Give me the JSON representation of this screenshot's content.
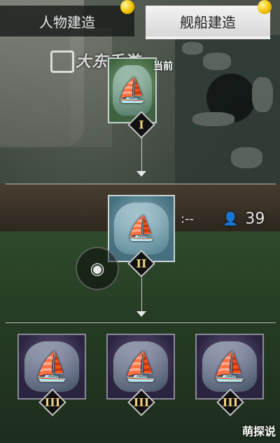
{
  "tabs": {
    "character_build": "人物建造",
    "ship_build": "舰船建造"
  },
  "watermark": "大东手游",
  "current_label": "当前",
  "tiers": {
    "tier1": "I",
    "tier2": "II",
    "tier3": "III"
  },
  "hud": {
    "dash_text": ":--",
    "player_count": "39"
  },
  "corner_logo": "萌探说",
  "icons": {
    "tab_coin": "coin-icon",
    "ship": "ship-icon",
    "eye": "eye-icon",
    "person": "person-icon",
    "chevron": "chevron-down-icon"
  },
  "colors": {
    "tab_active_bg": "#f3f3f3",
    "tab_inactive_bg": "#1a1f1c",
    "tier_numeral": "#f3d37b",
    "coin": "#f2c200"
  }
}
